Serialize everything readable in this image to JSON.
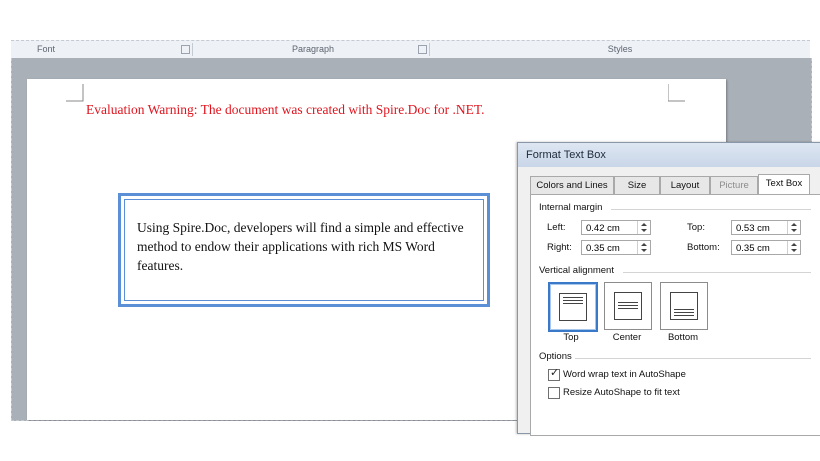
{
  "ribbon": {
    "groups": [
      {
        "label": "Font"
      },
      {
        "label": "Paragraph"
      },
      {
        "label": "Styles"
      }
    ]
  },
  "document": {
    "warning": "Evaluation Warning: The document was created with Spire.Doc for .NET.",
    "textbox_text": "Using Spire.Doc, developers will find a simple and effective method to endow their applications with rich MS Word features."
  },
  "dialog": {
    "title": "Format Text Box",
    "tabs": [
      {
        "label": "Colors and Lines"
      },
      {
        "label": "Size"
      },
      {
        "label": "Layout"
      },
      {
        "label": "Picture"
      },
      {
        "label": "Text Box"
      }
    ],
    "internal_margin": {
      "heading": "Internal margin",
      "left_label": "Left:",
      "left_value": "0.42 cm",
      "right_label": "Right:",
      "right_value": "0.35 cm",
      "top_label": "Top:",
      "top_value": "0.53 cm",
      "bottom_label": "Bottom:",
      "bottom_value": "0.35 cm"
    },
    "vertical_alignment": {
      "heading": "Vertical alignment",
      "options": [
        {
          "label": "Top"
        },
        {
          "label": "Center"
        },
        {
          "label": "Bottom"
        }
      ],
      "selected": "Top"
    },
    "options": {
      "heading": "Options",
      "word_wrap_label": "Word wrap text in AutoShape",
      "word_wrap_checked": true,
      "resize_label": "Resize AutoShape to fit text",
      "resize_checked": false
    }
  },
  "colors": {
    "warning": "#e0141e",
    "textbox_border": "#5b8fd6",
    "selection": "#3a78c8"
  }
}
